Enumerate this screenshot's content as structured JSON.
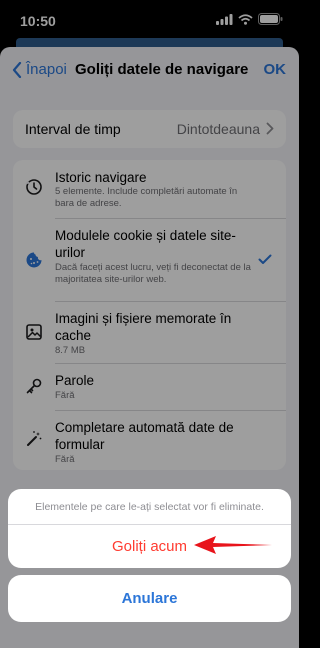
{
  "status": {
    "time": "10:50"
  },
  "nav": {
    "back_label": "Înapoi",
    "title": "Goliți datele de navigare",
    "ok_label": "OK"
  },
  "time_range": {
    "label": "Interval de timp",
    "value": "Dintotdeauna"
  },
  "items": [
    {
      "title": "Istoric navigare",
      "subtitle": "5 elemente. Include completări automate în bara de adrese.",
      "icon": "clock-history-icon",
      "checked": false
    },
    {
      "title": "Modulele cookie și datele site-urilor",
      "subtitle": "Dacă faceți acest lucru, veți fi deconectat de la majoritatea site-urilor web.",
      "icon": "cookie-icon",
      "checked": true
    },
    {
      "title": "Imagini și fișiere memorate în cache",
      "subtitle": "8.7 MB",
      "icon": "image-icon",
      "checked": false
    },
    {
      "title": "Parole",
      "subtitle": "Fără",
      "icon": "key-icon",
      "checked": false
    },
    {
      "title": "Completare automată date de formular",
      "subtitle": "Fără",
      "icon": "magic-wand-icon",
      "checked": false
    }
  ],
  "action_sheet": {
    "message": "Elementele pe care le-ați selectat vor fi eliminate.",
    "confirm_label": "Goliți acum",
    "cancel_label": "Anulare"
  },
  "colors": {
    "accent": "#2c76d8",
    "destructive": "#ff3b30",
    "arrow": "#e8141b"
  }
}
